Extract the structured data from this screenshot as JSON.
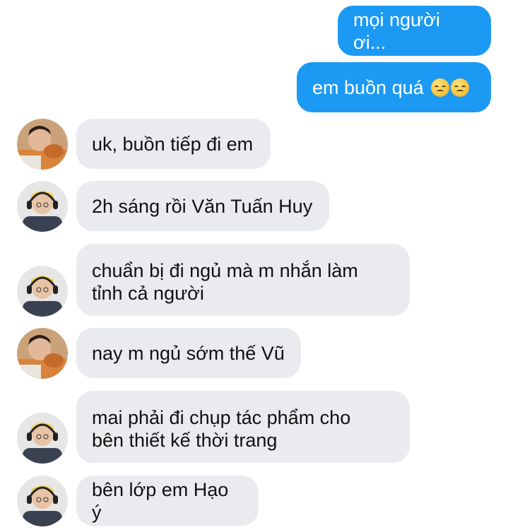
{
  "messages": [
    {
      "direction": "outgoing",
      "text": "mọi người ơi..."
    },
    {
      "direction": "outgoing",
      "text": "em buồn quá",
      "emoji": [
        "disappointed-face-icon",
        "disappointed-face-icon"
      ]
    },
    {
      "direction": "incoming",
      "sender_avatar": "avatar-orange-hoodie",
      "text": "uk, buồn tiếp đi em"
    },
    {
      "direction": "incoming",
      "sender_avatar": "avatar-headphones",
      "text": "2h sáng rồi Văn Tuấn Huy"
    },
    {
      "direction": "incoming",
      "sender_avatar": "avatar-headphones",
      "lines": [
        "chuẩn bị đi ngủ mà m nhắn làm",
        "tỉnh cả người"
      ]
    },
    {
      "direction": "incoming",
      "sender_avatar": "avatar-orange-hoodie",
      "text": "nay m ngủ sớm thế Vũ"
    },
    {
      "direction": "incoming",
      "sender_avatar": "avatar-headphones",
      "lines": [
        "mai phải đi chụp tác phẩm cho",
        "bên thiết kế thời trang"
      ]
    },
    {
      "direction": "incoming",
      "sender_avatar": "avatar-headphones",
      "text": "bên lớp em Hạo ý"
    }
  ],
  "colors": {
    "outgoing_bubble": "#1c9af3",
    "incoming_bubble": "#e9ebee",
    "background": "#ffffff"
  }
}
